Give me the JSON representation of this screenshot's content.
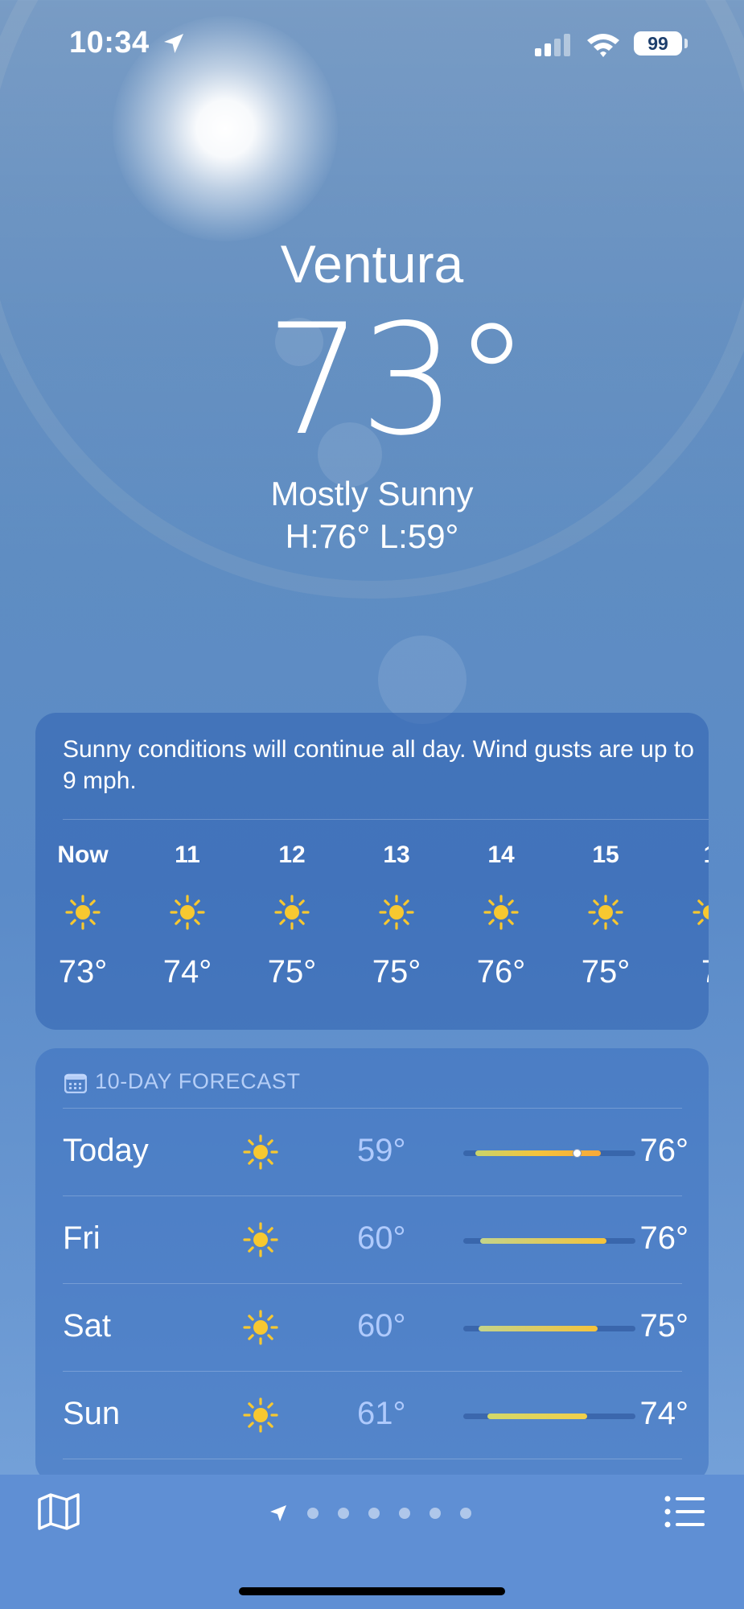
{
  "status_bar": {
    "time": "10:34",
    "battery": "99",
    "icons": [
      "location-arrow-icon",
      "cellular-signal-icon",
      "wifi-icon",
      "battery-icon"
    ]
  },
  "header": {
    "city": "Ventura",
    "temperature": "73°",
    "condition": "Mostly Sunny",
    "high_low": "H:76°  L:59°"
  },
  "hourly": {
    "summary": "Sunny conditions will continue all day. Wind gusts are up to 9 mph.",
    "hours": [
      {
        "label": "Now",
        "icon": "sun-icon",
        "temp": "73°"
      },
      {
        "label": "11",
        "icon": "sun-icon",
        "temp": "74°"
      },
      {
        "label": "12",
        "icon": "sun-icon",
        "temp": "75°"
      },
      {
        "label": "13",
        "icon": "sun-icon",
        "temp": "75°"
      },
      {
        "label": "14",
        "icon": "sun-icon",
        "temp": "76°"
      },
      {
        "label": "15",
        "icon": "sun-icon",
        "temp": "75°"
      },
      {
        "label": "1",
        "icon": "sun-icon",
        "temp": "7"
      }
    ]
  },
  "forecast": {
    "title": "10-DAY FORECAST",
    "title_icon": "calendar-icon",
    "days": [
      {
        "day": "Today",
        "icon": "sun-icon",
        "low": "59°",
        "high": "76°",
        "range_start": 0.07,
        "range_end": 0.8,
        "current_marker": 0.66,
        "colors": [
          "#c9d46a",
          "#f5c33b",
          "#f6a93a"
        ]
      },
      {
        "day": "Fri",
        "icon": "sun-icon",
        "low": "60°",
        "high": "76°",
        "range_start": 0.1,
        "range_end": 0.83,
        "colors": [
          "#c4d48a",
          "#f5c33b"
        ]
      },
      {
        "day": "Sat",
        "icon": "sun-icon",
        "low": "60°",
        "high": "75°",
        "range_start": 0.09,
        "range_end": 0.78,
        "colors": [
          "#c4d48a",
          "#f5c33b"
        ]
      },
      {
        "day": "Sun",
        "icon": "sun-icon",
        "low": "61°",
        "high": "74°",
        "range_start": 0.14,
        "range_end": 0.72,
        "colors": [
          "#d2d86a",
          "#f2cf4a"
        ]
      }
    ]
  },
  "toolbar": {
    "map_icon": "map-icon",
    "page_count": 6,
    "list_icon": "list-icon"
  },
  "colors": {
    "sun": "#f7c830",
    "sky_top": "#5b86b8",
    "toolbar": "#5f8fd4"
  }
}
